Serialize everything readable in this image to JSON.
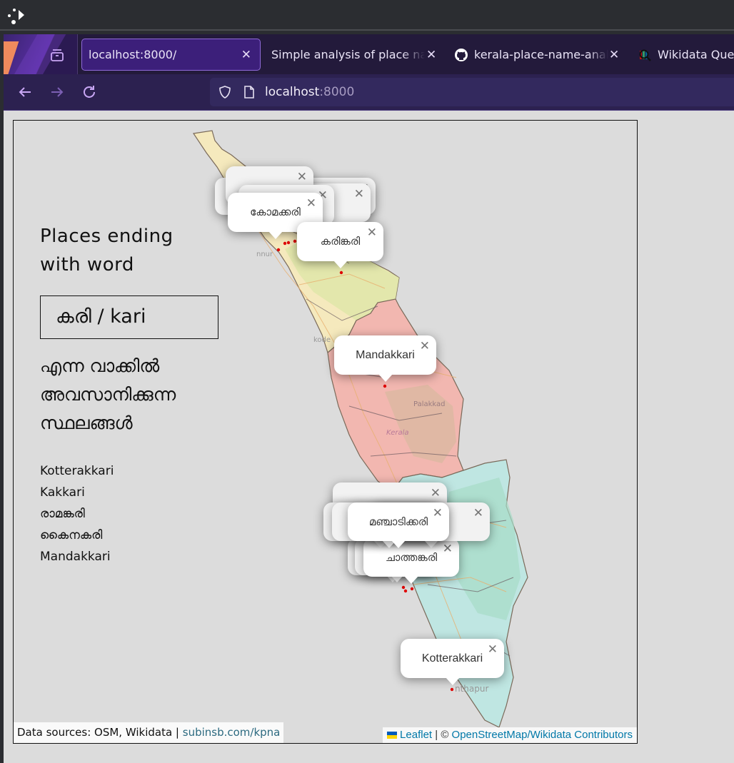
{
  "browser": {
    "tabs": [
      {
        "label": "localhost:8000/",
        "active": true,
        "icon": "none"
      },
      {
        "label": "Simple analysis of place names",
        "active": false,
        "icon": "none"
      },
      {
        "label": "kerala-place-name-analysis",
        "active": false,
        "icon": "github-icon"
      },
      {
        "label": "Wikidata Query Service",
        "active": false,
        "icon": "wikidata-query-icon"
      }
    ],
    "url": {
      "host": "localhost",
      "port": ":8000"
    }
  },
  "sidebar": {
    "title_line1": "Places ending",
    "title_line2": "with word",
    "word": "കരി / kari",
    "subtitle_line1": "എന്ന വാക്കിൽ",
    "subtitle_line2": "അവസാനിക്കുന്ന",
    "subtitle_line3": "സ്ഥലങ്ങൾ",
    "places": [
      "Kotterakkari",
      "Kakkari",
      "രാമങ്കരി",
      "കൈനകരി",
      "Mandakkari"
    ]
  },
  "map": {
    "labels": {
      "kannur": "nnur",
      "kozhikode": "kode",
      "palakkad": "Palakkad",
      "kerala": "Kerala",
      "thiruvananthapuram": "nthapur"
    },
    "popups": {
      "komakkari": "കോമക്കരി",
      "karingkari": "കരിങ്കരി",
      "mandakkari": "Mandakkari",
      "manjadikkari": "മഞ്ചാടിക്കരി",
      "chathankari": "ചാത്തങ്കരി",
      "kotterakkari": "Kotterakkari"
    },
    "marker_color": "#e00000",
    "attribution_left_text": "Data sources: OSM, Wikidata | ",
    "attribution_left_link": "subinsb.com/kpna",
    "attribution_right_leaflet": "Leaflet",
    "attribution_right_sep": " | © ",
    "attribution_right_link": "OpenStreetMap/Wikidata Contributors"
  }
}
